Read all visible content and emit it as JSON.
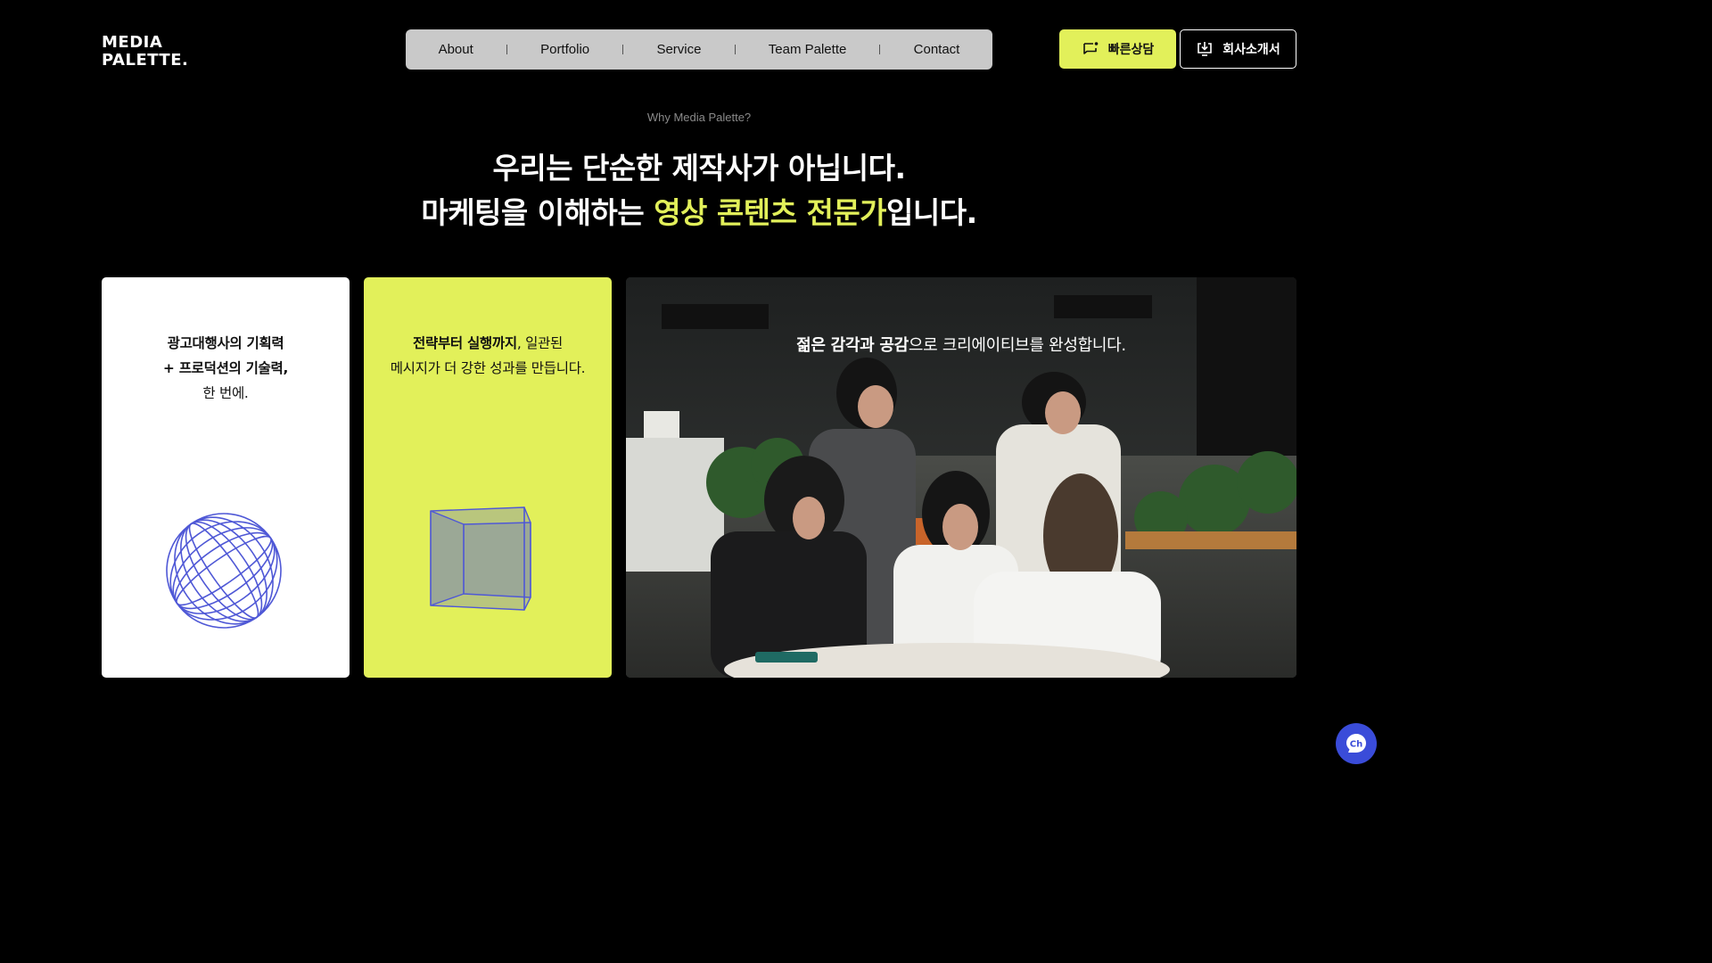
{
  "logo": {
    "line1": "MEDIA",
    "line2": "PALETTE."
  },
  "nav": {
    "items": [
      {
        "label": "About"
      },
      {
        "label": "Portfolio"
      },
      {
        "label": "Service"
      },
      {
        "label": "Team Palette"
      },
      {
        "label": "Contact"
      }
    ]
  },
  "actions": {
    "consult_label": "빠른상담",
    "intro_label": "회사소개서"
  },
  "hero": {
    "eyebrow": "Why Media Palette?",
    "line1": "우리는 단순한 제작사가 아닙니다.",
    "line2_prefix": "마케팅을 이해하는 ",
    "line2_highlight": "영상 콘텐츠 전문가",
    "line2_suffix": "입니다."
  },
  "cards": {
    "white": {
      "line1": "광고대행사의 기획력",
      "line2": "+ 프로덕션의 기술력,",
      "line3": "한 번에."
    },
    "lime": {
      "line1_bold": "전략부터 실행까지",
      "line1_rest": ", 일관된",
      "line2": "메시지가 더 강한 성과를 만듭니다."
    },
    "photo": {
      "bold": "젊은 감각과 공감",
      "rest": "으로 크리에이티브를 완성합니다."
    }
  },
  "chat": {
    "icon_text": "Ch"
  },
  "colors": {
    "accent": "#e2f05a",
    "background": "#000000",
    "chat": "#3a4cd9",
    "line_art": "#4f58d6"
  }
}
